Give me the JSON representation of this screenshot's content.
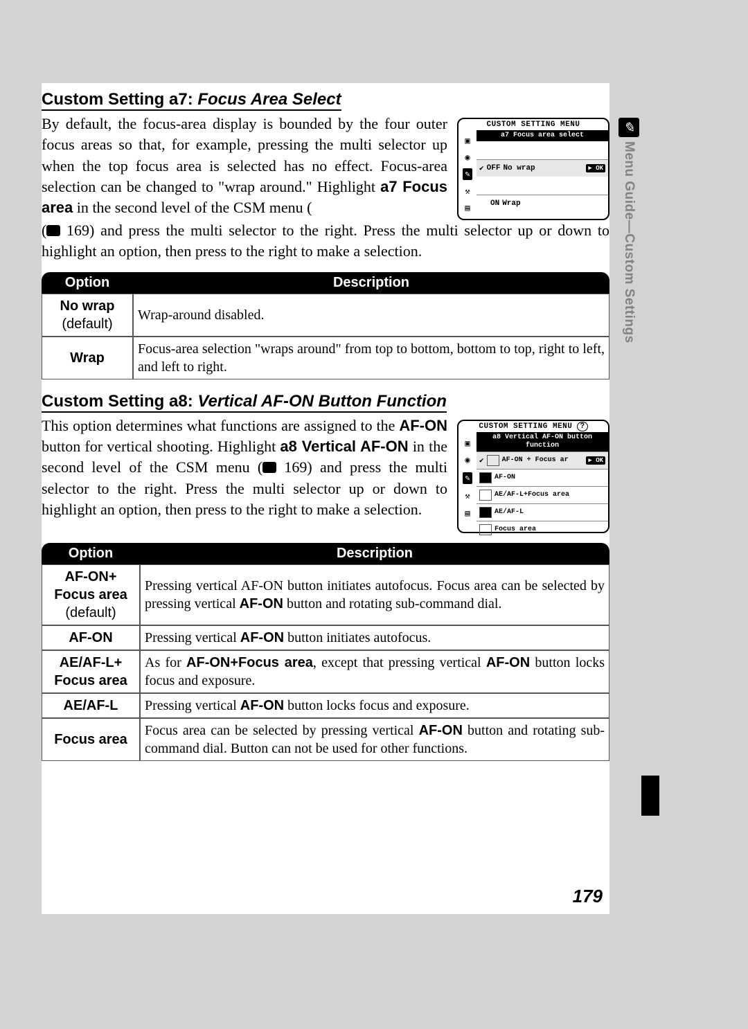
{
  "sideTab": "Menu Guide—Custom Settings",
  "pageNumber": "179",
  "a7": {
    "headingPrefix": "Custom Setting a7: ",
    "headingTitle": "Focus Area Select",
    "para1": "By default, the focus-area display is bounded by the four outer focus areas so that, for example, pressing the multi selector up when the top focus area is selected has no effect. Focus-area selection can be changed to \"wrap around.\" Highlight ",
    "bold1": "a7 Focus area",
    "para2": " in the second level of the CSM menu (",
    "ref": " 169) and press the multi selector to the right. Press the multi selector up or down to highlight an option, then press to the right to make a selection.",
    "lcd": {
      "title": "CUSTOM SETTING MENU",
      "sub": "a7 Focus area select",
      "opt1a": "OFF",
      "opt1b": "No wrap",
      "ok": "▶ OK",
      "opt2a": "ON",
      "opt2b": "Wrap"
    },
    "table": {
      "h1": "Option",
      "h2": "Description",
      "r1": {
        "opt": "No wrap",
        "sub": "(default)",
        "desc": "Wrap-around disabled."
      },
      "r2": {
        "opt": "Wrap",
        "desc": "Focus-area selection \"wraps around\" from top to bottom, bottom to top, right to left, and left to right."
      }
    }
  },
  "a8": {
    "headingPrefix": "Custom Setting a8: ",
    "headingTitle": "Vertical AF-ON Button Function",
    "para1": "This option determines what functions are assigned to the ",
    "bold1": "AF-ON",
    "para2": " button for vertical shooting. Highlight ",
    "bold2": "a8 Vertical AF-ON",
    "para3": " in the second level of the CSM menu (",
    "ref": " 169) and press the multi selector to the right. Press the multi selector up or down to highlight an option, then press to the right to make a selection.",
    "lcd": {
      "title": "CUSTOM SETTING MENU",
      "sub": "a8 Vertical AF-ON button function",
      "opt1": "AF-ON + Focus ar",
      "ok": "▶ OK",
      "opt2": "AF-ON",
      "opt3": "AE/AF-L+Focus area",
      "opt4": "AE/AF-L",
      "opt5": "Focus area"
    },
    "table": {
      "h1": "Option",
      "h2": "Description",
      "r1": {
        "opt1": "AF-ON+",
        "opt2": "Focus area",
        "sub": "(default)",
        "d1": "Pressing vertical AF-ON button initiates autofocus. Focus area can be selected by pressing vertical ",
        "db": "AF-ON",
        "d2": " button and rotating sub-command dial."
      },
      "r2": {
        "opt": "AF-ON",
        "d1": "Pressing vertical ",
        "db": "AF-ON",
        "d2": " button initiates autofocus."
      },
      "r3": {
        "opt1": "AE/AF-L+",
        "opt2": "Focus area",
        "d1": "As for ",
        "db1": "AF-ON+Focus area",
        "d2": ", except that pressing vertical ",
        "db2": "AF-ON",
        "d3": " button locks focus and exposure."
      },
      "r4": {
        "opt": "AE/AF-L",
        "d1": "Pressing vertical ",
        "db": "AF-ON",
        "d2": " button locks focus and exposure."
      },
      "r5": {
        "opt": "Focus area",
        "d1": "Focus area can be selected by pressing vertical ",
        "db": "AF-ON",
        "d2": " button and rotating sub-command dial. Button can not be used for other functions."
      }
    }
  }
}
